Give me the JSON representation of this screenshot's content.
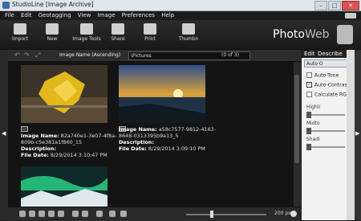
{
  "window": {
    "title": "StudioLine [Image Archive]"
  },
  "menu": [
    "File",
    "Edit",
    "Geotagging",
    "View",
    "Image",
    "Preferences",
    "Help"
  ],
  "toolbar": {
    "items": [
      {
        "label": "Import",
        "icon": "import-icon"
      },
      {
        "label": "New",
        "icon": "new-folder-icon"
      },
      {
        "label": "Image Tools",
        "icon": "image-tools-icon"
      },
      {
        "label": "Share",
        "icon": "share-icon"
      },
      {
        "label": "Print",
        "icon": "print-icon"
      },
      {
        "label": "Thumbn",
        "icon": "thumbnails-icon"
      }
    ],
    "mode_photo": "Photo",
    "mode_web": "Web"
  },
  "filter": {
    "sort": "Image Name (Ascending)",
    "path": "\\Pictures",
    "counter": "(0 of 3)"
  },
  "images": [
    {
      "name_label": "Image Name:",
      "name": "82a740e1-3e07-4f8a-809b-c5e381a1f860_15",
      "desc_label": "Description:",
      "date_label": "File Date:",
      "date": "8/29/2014 3:10:47 PM"
    },
    {
      "name_label": "Image Name:",
      "name": "a58c7577-9812-4163-8648-0313395b9a13_5",
      "desc_label": "Description:",
      "date_label": "File Date:",
      "date": "8/29/2014 3:09:10 PM"
    },
    {
      "name_label": "",
      "name": "",
      "desc_label": "",
      "date_label": "",
      "date": ""
    }
  ],
  "zoom_label": "200 px",
  "panel": {
    "tab_edit": "Edit",
    "tab_describe": "Describe",
    "auto_title": "Auto O",
    "options": [
      {
        "label": "Auto-Tone",
        "checked": false
      },
      {
        "label": "Auto-Contrast",
        "checked": true
      },
      {
        "label": "Calculate RGB-",
        "checked": false
      }
    ],
    "sliders": [
      "Highli",
      "Midto",
      "Shadi"
    ]
  }
}
